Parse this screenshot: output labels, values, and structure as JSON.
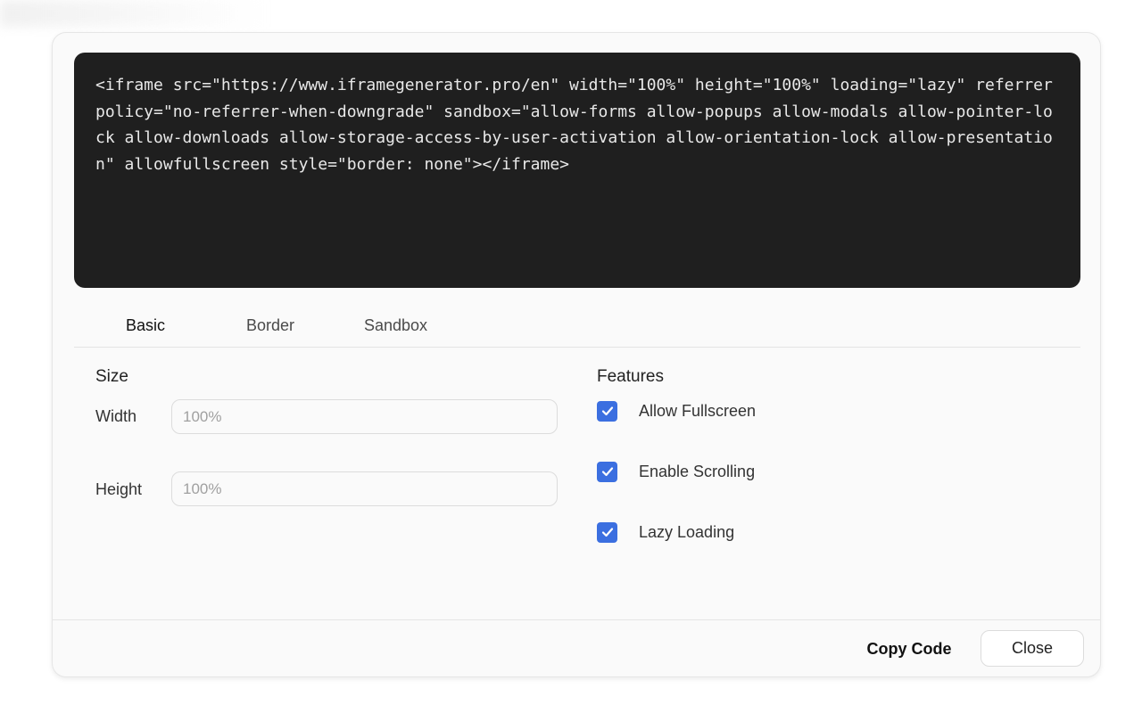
{
  "code": {
    "snippet": "<iframe src=\"https://www.iframegenerator.pro/en\" width=\"100%\" height=\"100%\" loading=\"lazy\" referrerpolicy=\"no-referrer-when-downgrade\" sandbox=\"allow-forms allow-popups allow-modals allow-pointer-lock allow-downloads allow-storage-access-by-user-activation allow-orientation-lock allow-presentation\" allowfullscreen style=\"border: none\"></iframe>"
  },
  "tabs": [
    {
      "label": "Basic",
      "active": true
    },
    {
      "label": "Border",
      "active": false
    },
    {
      "label": "Sandbox",
      "active": false
    }
  ],
  "size": {
    "title": "Size",
    "width_label": "Width",
    "width_placeholder": "100%",
    "height_label": "Height",
    "height_placeholder": "100%"
  },
  "features": {
    "title": "Features",
    "items": [
      {
        "label": "Allow Fullscreen",
        "checked": true
      },
      {
        "label": "Enable Scrolling",
        "checked": true
      },
      {
        "label": "Lazy Loading",
        "checked": true
      }
    ]
  },
  "footer": {
    "copy_label": "Copy Code",
    "close_label": "Close"
  },
  "colors": {
    "accent": "#3b6fe0",
    "code_bg": "#1f1f1f"
  }
}
